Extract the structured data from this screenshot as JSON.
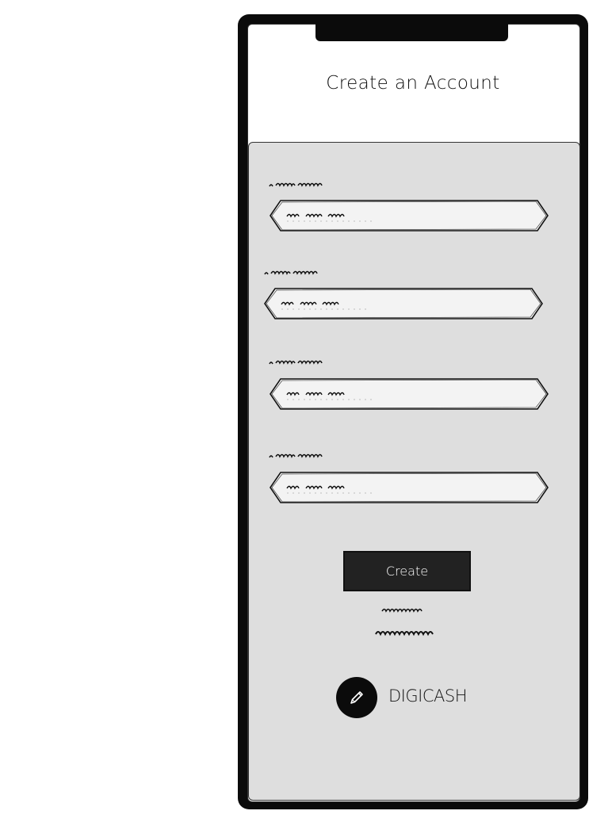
{
  "screen": {
    "title": "Create an Account"
  },
  "form": {
    "fields": [
      {
        "label_icon": "scribble-label",
        "placeholder_icon": "scribble-placeholder"
      },
      {
        "label_icon": "scribble-label",
        "placeholder_icon": "scribble-placeholder"
      },
      {
        "label_icon": "scribble-label",
        "placeholder_icon": "scribble-placeholder"
      },
      {
        "label_icon": "scribble-label",
        "placeholder_icon": "scribble-placeholder"
      }
    ],
    "submit_label": "Create"
  },
  "links": [
    {
      "icon": "scribble-link"
    },
    {
      "icon": "scribble-link"
    }
  ],
  "brand": {
    "name": "DIGICASH",
    "logo_icon": "pencil-icon"
  },
  "colors": {
    "frame": "#0b0b0b",
    "panel": "#dedede",
    "input_fill": "#f3f3f3",
    "button": "#222222",
    "button_text": "#ffffff"
  }
}
